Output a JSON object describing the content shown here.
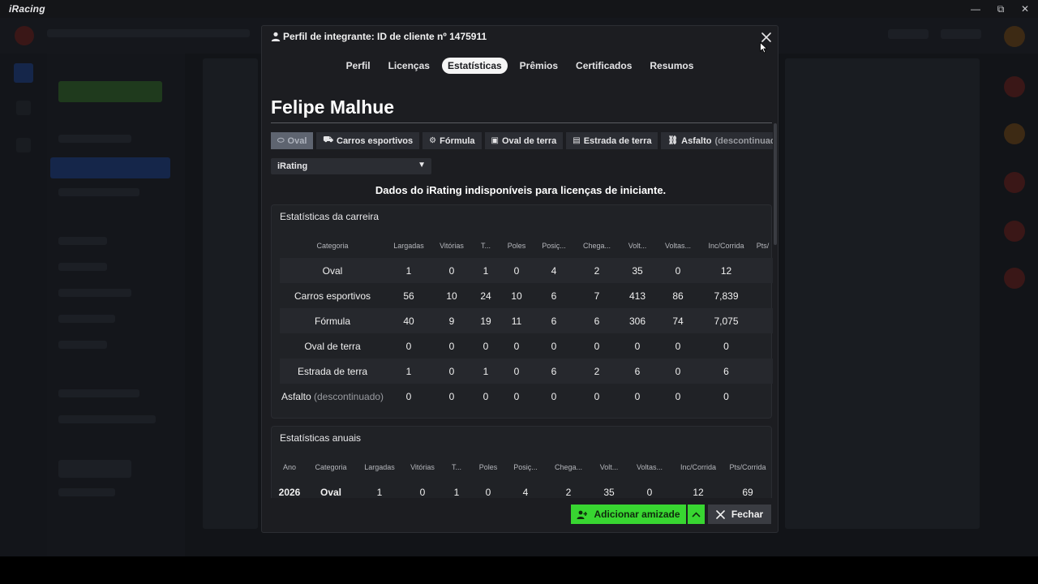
{
  "window": {
    "brand": "iRacing",
    "minimize": "—",
    "restore": "⧉",
    "close": "✕"
  },
  "modal": {
    "title": "Perfil de integrante: ID de cliente nº 1475911",
    "tabs": [
      {
        "label": "Perfil",
        "active": false
      },
      {
        "label": "Licenças",
        "active": false
      },
      {
        "label": "Estatísticas",
        "active": true
      },
      {
        "label": "Prêmios",
        "active": false
      },
      {
        "label": "Certificados",
        "active": false
      },
      {
        "label": "Resumos",
        "active": false
      }
    ],
    "driver_name": "Felipe Malhue",
    "category_tabs": [
      {
        "label": "Oval",
        "icon": "oval-icon",
        "glyph": "⬭",
        "active": true
      },
      {
        "label": "Carros esportivos",
        "icon": "sports-car-icon",
        "glyph": "⛟",
        "active": false
      },
      {
        "label": "Fórmula",
        "icon": "formula-car-icon",
        "glyph": "⚙",
        "active": false
      },
      {
        "label": "Oval de terra",
        "icon": "dirt-oval-icon",
        "glyph": "▣",
        "active": false
      },
      {
        "label": "Estrada de terra",
        "icon": "dirt-road-icon",
        "glyph": "▤",
        "active": false
      },
      {
        "label": "Asfalto",
        "suffix": "(descontinuado)",
        "icon": "asphalt-icon",
        "glyph": "⛓",
        "active": false
      }
    ],
    "rating_select": {
      "value": "iRating"
    },
    "notice": "Dados do iRating indisponíveis para licenças de iniciante.",
    "career": {
      "title": "Estatísticas da carreira",
      "headers": [
        "Categoria",
        "Largadas",
        "Vitórias",
        "T...",
        "Poles",
        "Posiç...",
        "Chega...",
        "Volt...",
        "Voltas...",
        "Inc/Corrida",
        "Pts/"
      ],
      "rows": [
        {
          "cat": "Oval",
          "vals": [
            "1",
            "0",
            "1",
            "0",
            "4",
            "2",
            "35",
            "0",
            "12"
          ]
        },
        {
          "cat": "Carros esportivos",
          "vals": [
            "56",
            "10",
            "24",
            "10",
            "6",
            "7",
            "413",
            "86",
            "7,839"
          ]
        },
        {
          "cat": "Fórmula",
          "vals": [
            "40",
            "9",
            "19",
            "11",
            "6",
            "6",
            "306",
            "74",
            "7,075"
          ]
        },
        {
          "cat": "Oval de terra",
          "vals": [
            "0",
            "0",
            "0",
            "0",
            "0",
            "0",
            "0",
            "0",
            "0"
          ]
        },
        {
          "cat": "Estrada de terra",
          "vals": [
            "1",
            "0",
            "1",
            "0",
            "6",
            "2",
            "6",
            "0",
            "6"
          ]
        },
        {
          "cat": "Asfalto",
          "cat_suffix": "(descontinuado)",
          "vals": [
            "0",
            "0",
            "0",
            "0",
            "0",
            "0",
            "0",
            "0",
            "0"
          ]
        }
      ]
    },
    "annual": {
      "title": "Estatísticas anuais",
      "headers": [
        "Ano",
        "Categoria",
        "Largadas",
        "Vitórias",
        "T...",
        "Poles",
        "Posiç...",
        "Chega...",
        "Volt...",
        "Voltas...",
        "Inc/Corrida",
        "Pts/Corrida"
      ],
      "rows": [
        {
          "vals": [
            "2026",
            "Oval",
            "1",
            "0",
            "1",
            "0",
            "4",
            "2",
            "35",
            "0",
            "12",
            "69"
          ]
        }
      ]
    },
    "footer": {
      "add_friend": "Adicionar amizade",
      "close": "Fechar"
    }
  }
}
